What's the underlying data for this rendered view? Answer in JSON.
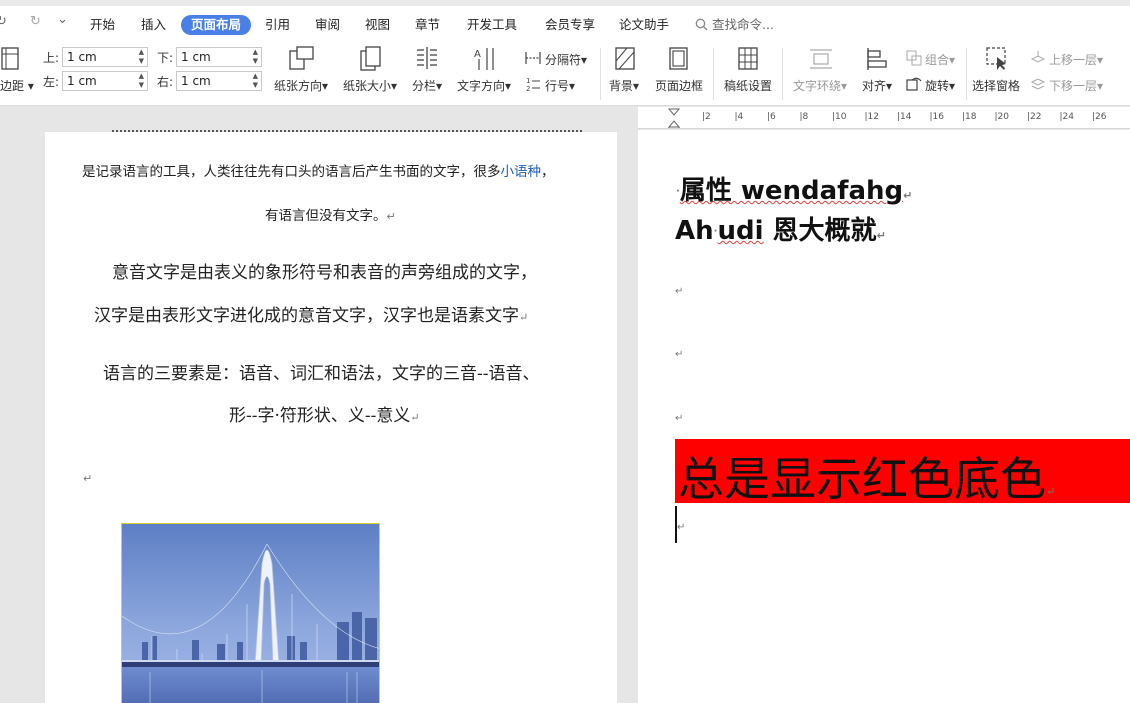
{
  "quick_access": {
    "undo_glyph": "↻",
    "redo_glyph": "↻",
    "more_glyph": "⌄"
  },
  "menu": {
    "tabs": [
      "开始",
      "插入",
      "页面布局",
      "引用",
      "审阅",
      "视图",
      "章节",
      "开发工具",
      "会员专享",
      "论文助手"
    ],
    "active_tab": "页面布局",
    "search_label": "查找命令..."
  },
  "ribbon": {
    "margin_label": "边距",
    "top_label": "上:",
    "top_value": "1 cm",
    "bottom_label": "下:",
    "bottom_value": "1 cm",
    "left_label": "左:",
    "left_value": "1 cm",
    "right_label": "右:",
    "right_value": "1 cm",
    "orientation_label": "纸张方向",
    "size_label": "纸张大小",
    "columns_label": "分栏",
    "text_direction_label": "文字方向",
    "separator_label": "分隔符",
    "line_number_label": "行号",
    "background_label": "背景",
    "page_border_label": "页面边框",
    "paper_setup_label": "稿纸设置",
    "text_wrap_label": "文字环绕",
    "align_label": "对齐",
    "group_label": "组合",
    "rotate_label": "旋转",
    "selection_pane_label": "选择窗格",
    "bring_forward_label": "上移一层",
    "send_backward_label": "下移一层"
  },
  "ruler": {
    "ticks": [
      "2",
      "4",
      "6",
      "8",
      "10",
      "12",
      "14",
      "16",
      "18",
      "20",
      "22",
      "24",
      "26"
    ]
  },
  "left_doc": {
    "line1_a": "是记录语言的工具，人类往往先有口头的语言后产生书面的文字，很多",
    "line1_link": "小语种",
    "line1_b": "，",
    "line2": "有语言但没有文字。",
    "para1_line1": "意音文字是由表义的象形符号和表音的声旁组成的文字，",
    "para1_line2": "汉字是由表形文字进化成的意音文字，汉字也是语素文字",
    "para2_line1": "语言的三要素是：语音、词汇和语法，文字的三音--语音、",
    "para2_line2": "形--字·符形状、义--意义",
    "para_mark": "↵",
    "image_label": "bridge-photo"
  },
  "right_doc": {
    "heading1": "属性 wendafahg",
    "heading2_a": "Ah",
    "heading2_b": "udi",
    "heading2_c": " 恩大概就",
    "para_mark": "↵",
    "red_text": "总是显示红色底色",
    "red_bg_color": "#ff0000"
  }
}
